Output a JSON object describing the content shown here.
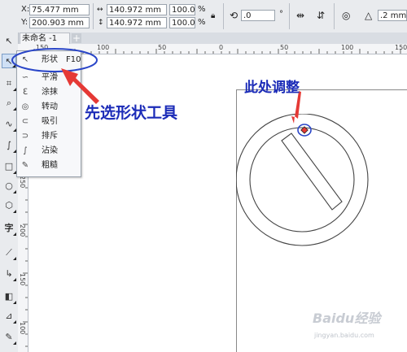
{
  "propbar": {
    "x_label": "X:",
    "x_value": "75.477 mm",
    "y_label": "Y:",
    "y_value": "200.903 mm",
    "w_value": "140.972 mm",
    "h_value": "140.972 mm",
    "scale_w": "100.0",
    "scale_h": "100.0",
    "pct1": "%",
    "pct2": "%",
    "rotation": ".0",
    "degree": "°",
    "outline": ".2 mm"
  },
  "tabs": {
    "doc_name": "未命名 -1",
    "add": "+"
  },
  "ruler": {
    "h_labels": [
      "150",
      "100",
      "50",
      "0",
      "50",
      "100",
      "150"
    ],
    "v_labels": [
      "250",
      "200",
      "150",
      "100"
    ]
  },
  "flyout": {
    "items": [
      {
        "label": "形状",
        "shortcut": "F10",
        "icon": "shape-icon"
      },
      {
        "label": "平滑",
        "shortcut": "",
        "icon": "smooth-icon"
      },
      {
        "label": "涂抹",
        "shortcut": "",
        "icon": "smear-icon"
      },
      {
        "label": "转动",
        "shortcut": "",
        "icon": "twirl-icon"
      },
      {
        "label": "吸引",
        "shortcut": "",
        "icon": "attract-icon"
      },
      {
        "label": "排斥",
        "shortcut": "",
        "icon": "repel-icon"
      },
      {
        "label": "沾染",
        "shortcut": "",
        "icon": "smudge-icon"
      },
      {
        "label": "粗糙",
        "shortcut": "",
        "icon": "roughen-icon"
      }
    ]
  },
  "annotations": {
    "select_tool": "先选形状工具",
    "adjust_here": "此处调整"
  },
  "watermark": {
    "url": "jingyan.baidu.com"
  },
  "colors": {
    "annotation": "#1c2cb8",
    "arrow": "#e53935",
    "node": "#e53935"
  }
}
